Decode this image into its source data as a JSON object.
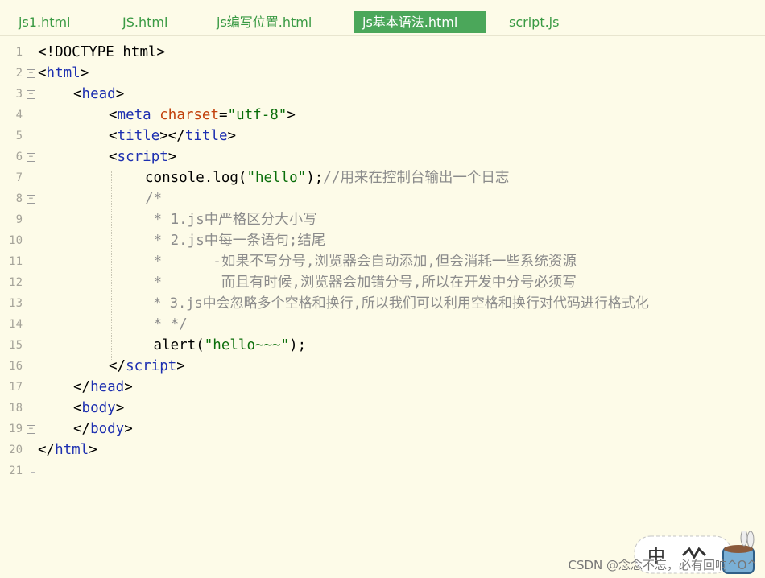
{
  "tabs": [
    {
      "label": "js1.html",
      "active": false
    },
    {
      "label": "JS.html",
      "active": false
    },
    {
      "label": "js编写位置.html",
      "active": false
    },
    {
      "label": "js基本语法.html",
      "active": true
    },
    {
      "label": "script.js",
      "active": false
    }
  ],
  "line_numbers": [
    "1",
    "2",
    "3",
    "4",
    "5",
    "6",
    "7",
    "8",
    "9",
    "10",
    "11",
    "12",
    "13",
    "14",
    "15",
    "16",
    "17",
    "18",
    "19",
    "20",
    "21"
  ],
  "code": {
    "l1": {
      "bracket_open": "<",
      "text": "!DOCTYPE html",
      "bracket_close": ">"
    },
    "l2": {
      "open": "<",
      "tag": "html",
      "close": ">"
    },
    "l3": {
      "open": "<",
      "tag": "head",
      "close": ">"
    },
    "l4": {
      "open": "<",
      "tag": "meta",
      "attr": "charset",
      "eq": "=",
      "value": "\"utf-8\"",
      "close": ">"
    },
    "l5": {
      "open": "<",
      "tag": "title",
      "mid": "></",
      "tag2": "title",
      "close": ">"
    },
    "l6": {
      "open": "<",
      "tag": "script",
      "close": ">"
    },
    "l7": {
      "code": "console.log(",
      "string": "\"hello\"",
      "end": ");",
      "comment": "//用来在控制台输出一个日志"
    },
    "l8": {
      "comment": "/*"
    },
    "l9": {
      "comment": " * 1.js中严格区分大小写"
    },
    "l10": {
      "comment": " * 2.js中每一条语句;结尾"
    },
    "l11": {
      "comment": " *      -如果不写分号,浏览器会自动添加,但会消耗一些系统资源"
    },
    "l12": {
      "comment": " *       而且有时候,浏览器会加错分号,所以在开发中分号必须写"
    },
    "l13": {
      "comment": " * 3.js中会忽略多个空格和换行,所以我们可以利用空格和换行对代码进行格式化"
    },
    "l14": {
      "comment": " * */"
    },
    "l15": {
      "code": " alert(",
      "string": "\"hello~~~\"",
      "end": ");"
    },
    "l16": {
      "open": "</",
      "tag": "script",
      "close": ">"
    },
    "l17": {
      "open": "</",
      "tag": "head",
      "close": ">"
    },
    "l18": {
      "open": "<",
      "tag": "body",
      "close": ">"
    },
    "l19": {
      "open": "</",
      "tag": "body",
      "close": ">"
    },
    "l20": {
      "open": "</",
      "tag": "html",
      "close": ">"
    }
  },
  "fold_markers": [
    2,
    3,
    6,
    8,
    18
  ],
  "watermark": "CSDN @念念不忘，必有回响^O^",
  "sticker_char": "中",
  "colors": {
    "background": "#fdfbe8",
    "tab_text": "#3a9a44",
    "tab_active_bg": "#4ba75a",
    "tag": "#1d2fb0",
    "attr": "#c2410c",
    "string": "#0a6e0a",
    "comment": "#8c8c8c"
  }
}
